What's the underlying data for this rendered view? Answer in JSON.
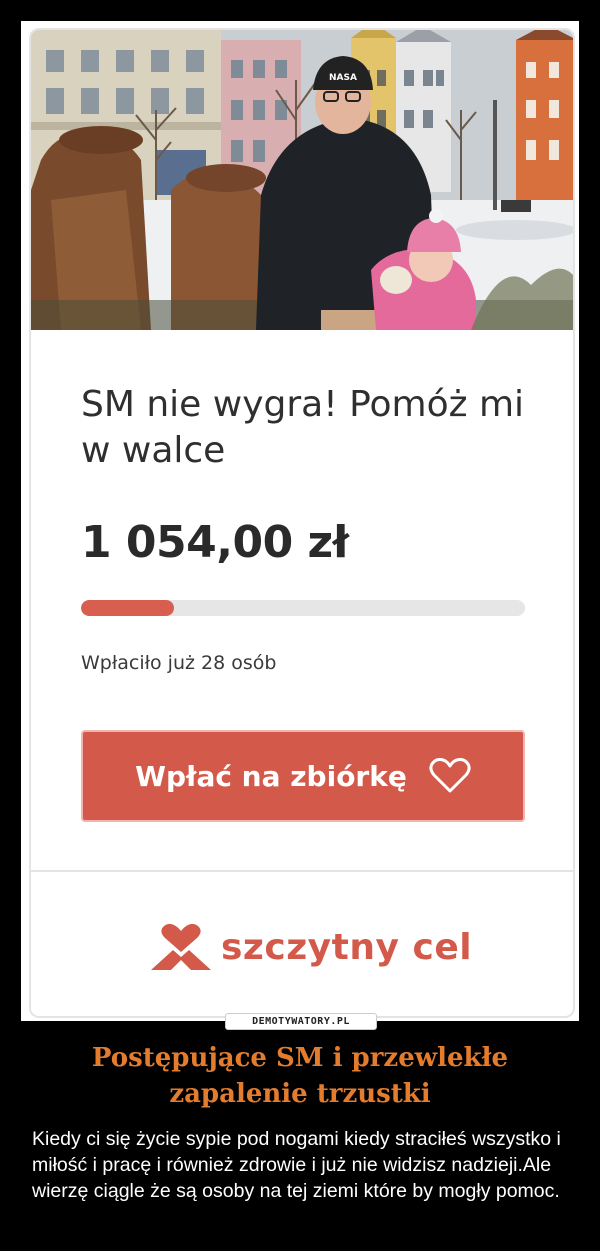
{
  "fundraiser": {
    "title": "SM nie wygra! Pomóż mi w walce",
    "amount": "1 054,00 zł",
    "progress_fraction": 0.21,
    "donors_text": "Wpłaciło już 28 osób",
    "donate_button_label": "Wpłać na zbiórkę",
    "donate_button_icon": "heart-outline-icon",
    "brand_name": "szczytny cel",
    "brand_icon": "heart-mountain-logo-icon",
    "photo_badge_text": "NASA"
  },
  "watermark": "DEMOTYWATORY.PL",
  "caption": {
    "title": "Postępujące SM i przewlekłe zapalenie trzustki",
    "text": "Kiedy ci się życie sypie pod nogami kiedy straciłeś wszystko i miłość i pracę i również zdrowie i już nie widzisz nadzieji.Ale wierzę ciągle że są osoby na tej ziemi które by mogły pomoc."
  },
  "colors": {
    "accent": "#d35a4a",
    "caption_title": "#e47c2e",
    "background": "#000000"
  }
}
